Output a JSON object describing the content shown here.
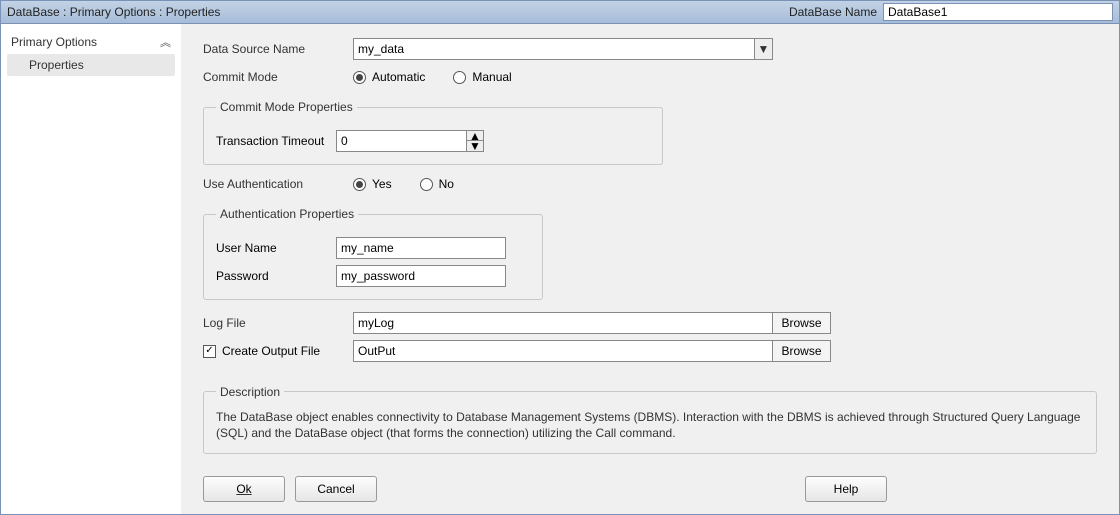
{
  "titlebar": {
    "breadcrumb": "DataBase : Primary Options : Properties",
    "name_label": "DataBase Name",
    "name_value": "DataBase1"
  },
  "sidebar": {
    "heading": "Primary Options",
    "child": "Properties"
  },
  "fields": {
    "data_source_label": "Data Source Name",
    "data_source_value": "my_data",
    "commit_mode_label": "Commit Mode",
    "commit_auto": "Automatic",
    "commit_manual": "Manual",
    "commit_props_legend": "Commit Mode Properties",
    "txn_timeout_label": "Transaction Timeout",
    "txn_timeout_value": "0",
    "use_auth_label": "Use Authentication",
    "yes": "Yes",
    "no": "No",
    "auth_legend": "Authentication Properties",
    "user_label": "User Name",
    "user_value": "my_name",
    "pass_label": "Password",
    "pass_value": "my_password",
    "logfile_label": "Log File",
    "logfile_value": "myLog",
    "browse": "Browse",
    "create_output_label": "Create Output File",
    "output_value": "OutPut"
  },
  "description": {
    "legend": "Description",
    "text": "The DataBase object enables connectivity to Database Management Systems (DBMS).  Interaction with the DBMS is achieved through Structured Query Language (SQL) and the DataBase object (that forms the connection) utilizing the Call command."
  },
  "buttons": {
    "ok": "Ok",
    "cancel": "Cancel",
    "help": "Help"
  }
}
